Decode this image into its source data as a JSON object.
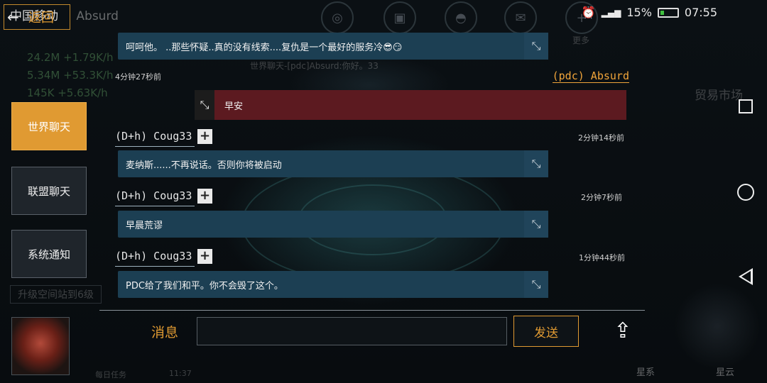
{
  "status_bar": {
    "carrier": "中国移动",
    "game_name": "Absurd",
    "battery": "15%",
    "time": "07:55"
  },
  "back_button": {
    "label": "返回"
  },
  "background": {
    "resources": [
      "24.2M +1.79K/h",
      "5.34M +53.3K/h",
      "145K +5.63K/h"
    ],
    "world_line": "世界聊天-[pdc]Absurd:你好。33",
    "trade_market": "贸易市场",
    "more": "更多",
    "upgrade": "升级空间站到6级",
    "daily_tasks": "每日任务",
    "timer": "11:37",
    "star_system": "星系",
    "nebula": "星云"
  },
  "tabs": [
    {
      "label": "世界聊天",
      "active": true
    },
    {
      "label": "联盟聊天",
      "active": false
    },
    {
      "label": "系统通知",
      "active": false
    }
  ],
  "chat": {
    "top_message": {
      "text": "呵呵他。 ..那些怀疑..真的没有线索....复仇是一个最好的服务冷😎😏"
    },
    "my_message": {
      "time": "4分钟27秒前",
      "sender": "(pdc) Absurd",
      "text": "早安"
    },
    "messages": [
      {
        "sender": "(D+h) Coug33",
        "time": "2分钟14秒前",
        "text": "麦纳斯......不再说话。否则你将被启动"
      },
      {
        "sender": "(D+h) Coug33",
        "time": "2分钟7秒前",
        "text": "早晨荒谬"
      },
      {
        "sender": "(D+h) Coug33",
        "time": "1分钟44秒前",
        "text": "PDC给了我们和平。你不会毁了这个。"
      }
    ]
  },
  "input_area": {
    "label": "消息",
    "placeholder": "",
    "send_label": "发送"
  },
  "icons": {
    "expand": "expand-arrows-icon",
    "plus": "plus-icon",
    "upload": "upload-icon"
  },
  "colors": {
    "accent": "#e09a32",
    "bubble": "#1c3f53",
    "my_bubble": "#5c1a20"
  }
}
